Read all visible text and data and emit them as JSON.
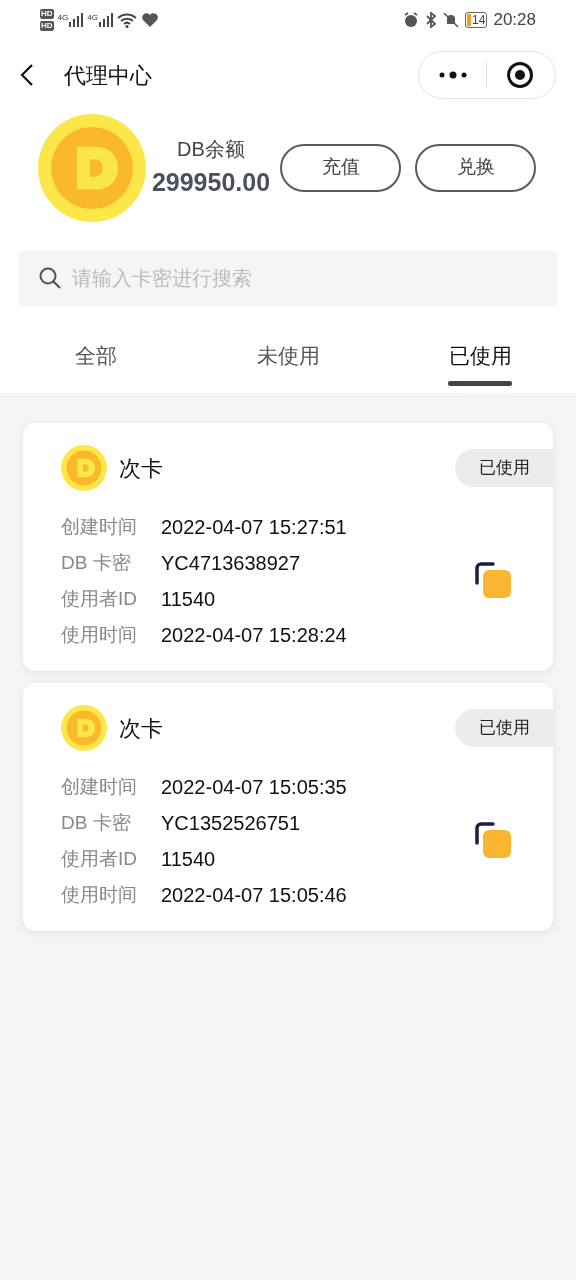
{
  "status_bar": {
    "hd_labels": [
      "HD",
      "HD"
    ],
    "network_labels": [
      "4G",
      "4G"
    ],
    "battery": "14",
    "time": "20:28"
  },
  "header": {
    "title": "代理中心"
  },
  "balance": {
    "label": "DB余额",
    "amount": "299950.00",
    "buttons": [
      "充值",
      "兑换"
    ]
  },
  "search": {
    "placeholder": "请输入卡密进行搜索"
  },
  "tabs": [
    {
      "label": "全部",
      "selected": false
    },
    {
      "label": "未使用",
      "selected": false
    },
    {
      "label": "已使用",
      "selected": true
    }
  ],
  "cards": [
    {
      "title": "次卡",
      "status": "已使用",
      "fields": [
        {
          "label": "创建时间",
          "value": "2022-04-07 15:27:51"
        },
        {
          "label": "DB 卡密",
          "value": "YC4713638927"
        },
        {
          "label": "使用者ID",
          "value": "11540"
        },
        {
          "label": "使用时间",
          "value": "2022-04-07 15:28:24"
        }
      ]
    },
    {
      "title": "次卡",
      "status": "已使用",
      "fields": [
        {
          "label": "创建时间",
          "value": "2022-04-07 15:05:35"
        },
        {
          "label": "DB 卡密",
          "value": "YC1352526751"
        },
        {
          "label": "使用者ID",
          "value": "11540"
        },
        {
          "label": "使用时间",
          "value": "2022-04-07 15:05:46"
        }
      ]
    }
  ]
}
